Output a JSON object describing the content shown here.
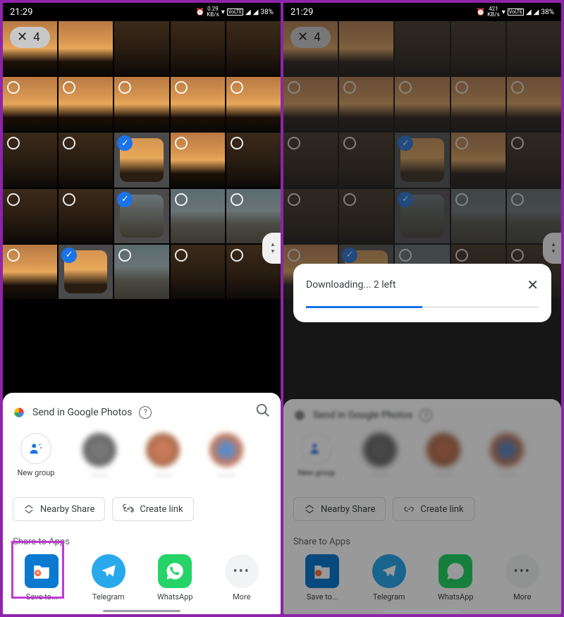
{
  "status": {
    "time": "21:29",
    "net_label": "0.29\nKB/s",
    "net_label2": "421\nKB/s",
    "battery": "38%",
    "vo": "VoLTE"
  },
  "selection": {
    "count": "4"
  },
  "sheet": {
    "title": "Send in Google Photos",
    "new_group": "New group",
    "contacts": [
      {
        "name": "New group"
      },
      {
        "name": "—"
      },
      {
        "name": "—"
      },
      {
        "name": "—"
      }
    ],
    "actions": {
      "nearby": "Nearby Share",
      "link": "Create link"
    },
    "section": "Share to Apps",
    "apps": {
      "save": "Save to...",
      "telegram": "Telegram",
      "whatsapp": "WhatsApp",
      "more": "More"
    }
  },
  "download": {
    "text": "Downloading... 2 left"
  }
}
